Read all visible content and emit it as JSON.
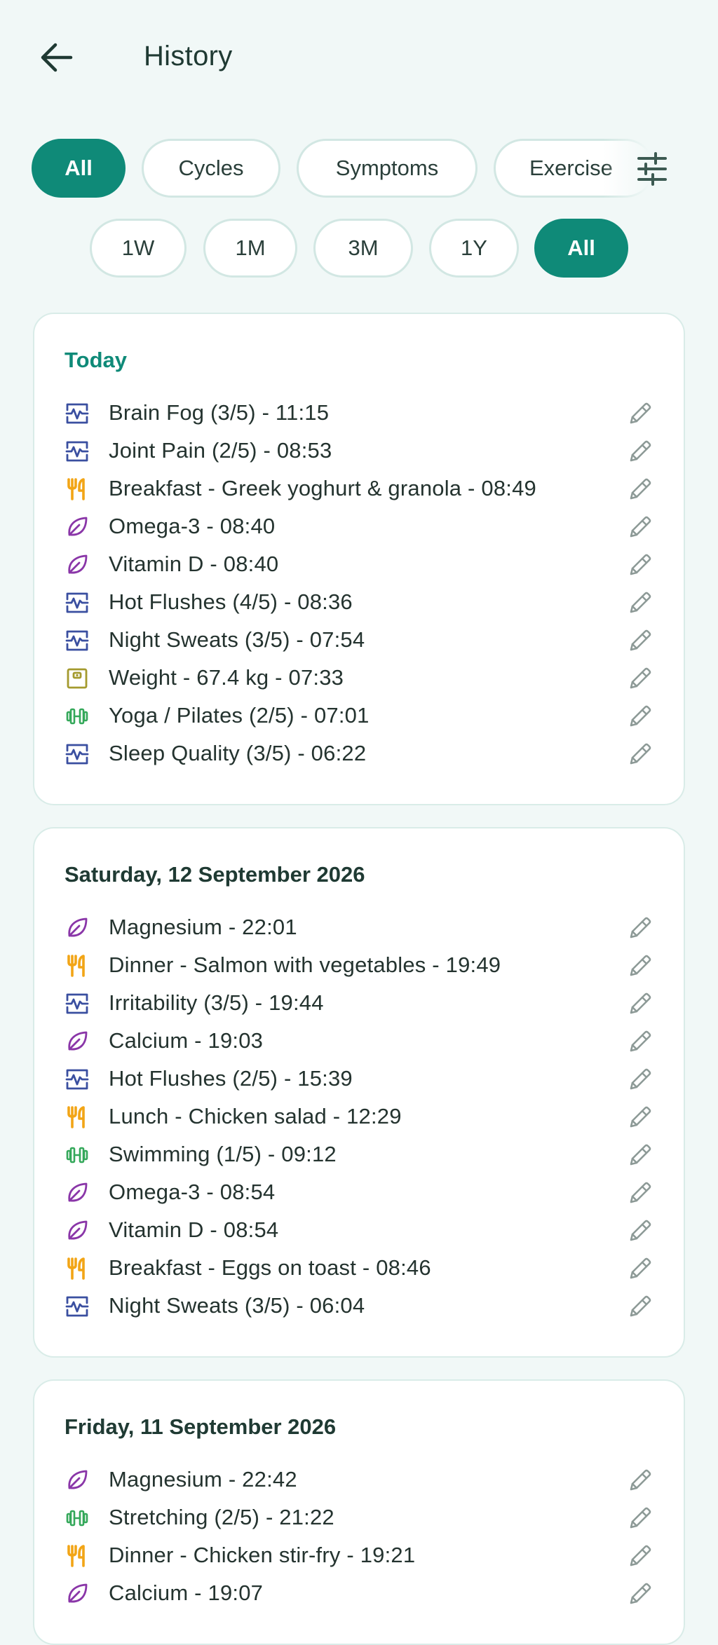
{
  "header": {
    "title": "History"
  },
  "category_filters": [
    {
      "label": "All",
      "active": true
    },
    {
      "label": "Cycles",
      "active": false
    },
    {
      "label": "Symptoms",
      "active": false
    },
    {
      "label": "Exercise",
      "active": false
    }
  ],
  "range_filters": [
    {
      "label": "1W",
      "active": false
    },
    {
      "label": "1M",
      "active": false
    },
    {
      "label": "3M",
      "active": false
    },
    {
      "label": "1Y",
      "active": false
    },
    {
      "label": "All",
      "active": true
    }
  ],
  "colors": {
    "accent": "#0f8a78",
    "symptom_icon": "#3a4fa0",
    "meal_icon": "#f2a516",
    "supplement_icon": "#8a36a8",
    "weight_icon": "#a49a2e",
    "exercise_icon": "#34a85a"
  },
  "days": [
    {
      "heading": "Today",
      "entries": [
        {
          "icon": "symptom-icon",
          "text": "Brain Fog (3/5) - 11:15"
        },
        {
          "icon": "symptom-icon",
          "text": "Joint Pain (2/5) - 08:53"
        },
        {
          "icon": "meal-icon",
          "text": "Breakfast - Greek yoghurt & granola - 08:49"
        },
        {
          "icon": "supplement-icon",
          "text": "Omega-3 - 08:40"
        },
        {
          "icon": "supplement-icon",
          "text": "Vitamin D - 08:40"
        },
        {
          "icon": "symptom-icon",
          "text": "Hot Flushes (4/5) - 08:36"
        },
        {
          "icon": "symptom-icon",
          "text": "Night Sweats (3/5) - 07:54"
        },
        {
          "icon": "weight-icon",
          "text": "Weight - 67.4 kg - 07:33"
        },
        {
          "icon": "exercise-icon",
          "text": "Yoga / Pilates (2/5) - 07:01"
        },
        {
          "icon": "symptom-icon",
          "text": "Sleep Quality (3/5) - 06:22"
        }
      ]
    },
    {
      "heading": "Saturday, 12 September 2026",
      "entries": [
        {
          "icon": "supplement-icon",
          "text": "Magnesium - 22:01"
        },
        {
          "icon": "meal-icon",
          "text": "Dinner - Salmon with vegetables - 19:49"
        },
        {
          "icon": "symptom-icon",
          "text": "Irritability (3/5) - 19:44"
        },
        {
          "icon": "supplement-icon",
          "text": "Calcium - 19:03"
        },
        {
          "icon": "symptom-icon",
          "text": "Hot Flushes (2/5) - 15:39"
        },
        {
          "icon": "meal-icon",
          "text": "Lunch - Chicken salad - 12:29"
        },
        {
          "icon": "exercise-icon",
          "text": "Swimming (1/5) - 09:12"
        },
        {
          "icon": "supplement-icon",
          "text": "Omega-3 - 08:54"
        },
        {
          "icon": "supplement-icon",
          "text": "Vitamin D - 08:54"
        },
        {
          "icon": "meal-icon",
          "text": "Breakfast - Eggs on toast - 08:46"
        },
        {
          "icon": "symptom-icon",
          "text": "Night Sweats (3/5) - 06:04"
        }
      ]
    },
    {
      "heading": "Friday, 11 September 2026",
      "entries": [
        {
          "icon": "supplement-icon",
          "text": "Magnesium - 22:42"
        },
        {
          "icon": "exercise-icon",
          "text": "Stretching (2/5) - 21:22"
        },
        {
          "icon": "meal-icon",
          "text": "Dinner - Chicken stir-fry - 19:21"
        },
        {
          "icon": "supplement-icon",
          "text": "Calcium - 19:07"
        }
      ]
    }
  ]
}
